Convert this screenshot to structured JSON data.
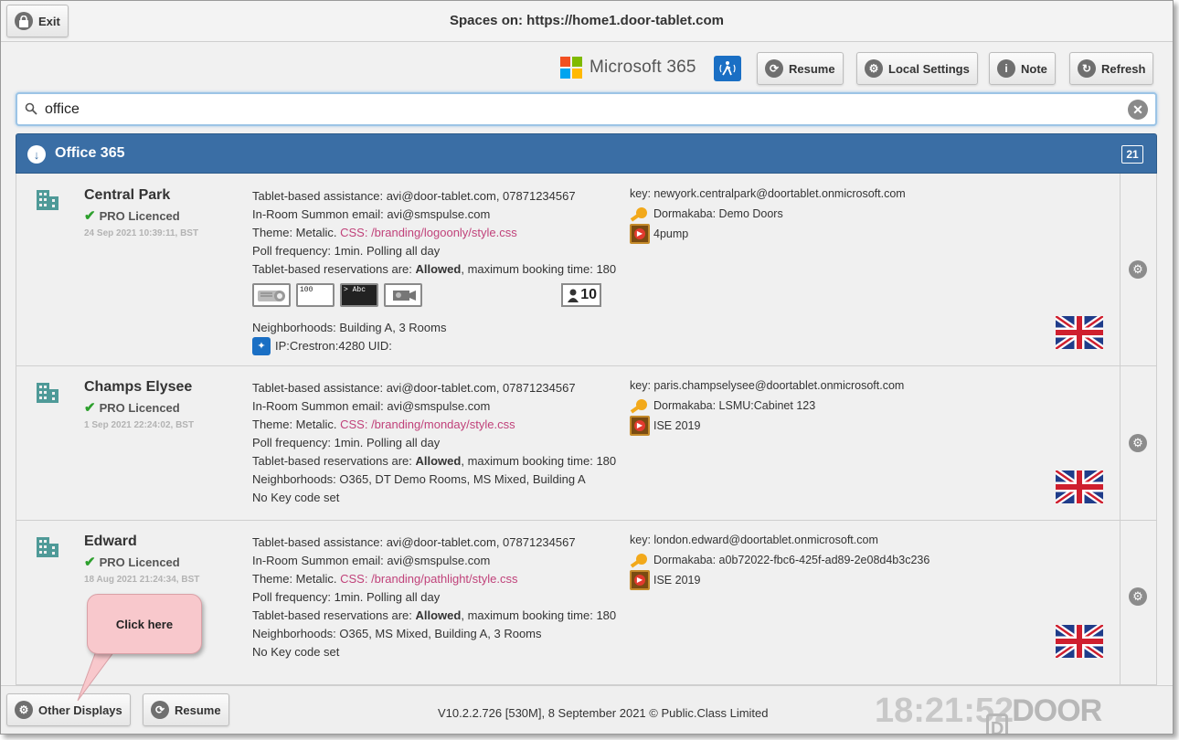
{
  "header": {
    "exit_label": "Exit",
    "title": "Spaces on: https://home1.door-tablet.com"
  },
  "toolbar": {
    "ms_brand": "Microsoft 365",
    "resume_label": "Resume",
    "local_settings_label": "Local Settings",
    "note_label": "Note",
    "refresh_label": "Refresh"
  },
  "search": {
    "value": "office"
  },
  "group": {
    "name": "Office 365",
    "count": "21"
  },
  "rooms": [
    {
      "name": "Central Park",
      "license": "PRO Licenced",
      "timestamp": "24 Sep 2021 10:39:11, BST",
      "assistance": "Tablet-based assistance: avi@door-tablet.com, 07871234567",
      "summon": "In-Room Summon email: avi@smspulse.com",
      "theme_prefix": "Theme: Metalic.",
      "theme_css": "CSS: /branding/logoonly/style.css",
      "poll": "Poll frequency: 1min. Polling all day",
      "res_prefix": "Tablet-based reservations are:",
      "res_allowed": "Allowed",
      "res_suffix": ", maximum booking time: 180",
      "neighborhoods": "Neighborhoods: Building A, 3 Rooms",
      "ip": "IP:Crestron:4280 UID:",
      "capacity": "10",
      "key": "key: newyork.centralpark@doortablet.onmicrosoft.com",
      "dormakaba": "Dormakaba: Demo Doors",
      "media": "4pump",
      "equipment": [
        "projector",
        "100",
        "> Abc",
        "camera"
      ]
    },
    {
      "name": "Champs Elysee",
      "license": "PRO Licenced",
      "timestamp": "1 Sep 2021 22:24:02, BST",
      "assistance": "Tablet-based assistance: avi@door-tablet.com, 07871234567",
      "summon": "In-Room Summon email: avi@smspulse.com",
      "theme_prefix": "Theme: Metalic.",
      "theme_css": "CSS: /branding/monday/style.css",
      "poll": "Poll frequency: 1min. Polling all day",
      "res_prefix": "Tablet-based reservations are:",
      "res_allowed": "Allowed",
      "res_suffix": ", maximum booking time: 180",
      "neighborhoods": "Neighborhoods: O365, DT Demo Rooms, MS Mixed, Building A",
      "keycode": "No Key code set",
      "key": "key: paris.champselysee@doortablet.onmicrosoft.com",
      "dormakaba": "Dormakaba: LSMU:Cabinet 123",
      "media": "ISE 2019"
    },
    {
      "name": "Edward",
      "license": "PRO Licenced",
      "timestamp": "18 Aug 2021 21:24:34, BST",
      "assistance": "Tablet-based assistance: avi@door-tablet.com, 07871234567",
      "summon": "In-Room Summon email: avi@smspulse.com",
      "theme_prefix": "Theme: Metalic.",
      "theme_css": "CSS: /branding/pathlight/style.css",
      "poll": "Poll frequency: 1min. Polling all day",
      "res_prefix": "Tablet-based reservations are:",
      "res_allowed": "Allowed",
      "res_suffix": ", maximum booking time: 180",
      "neighborhoods": "Neighborhoods: O365, MS Mixed, Building A, 3 Rooms",
      "keycode": "No Key code set",
      "key": "key: london.edward@doortablet.onmicrosoft.com",
      "dormakaba": "Dormakaba: a0b72022-fbc6-425f-ad89-2e08d4b3c236",
      "media": "ISE 2019"
    }
  ],
  "footer": {
    "other_displays_label": "Other Displays",
    "resume_label": "Resume",
    "version": "V10.2.2.726 [530M], 8 September 2021 © Public.Class Limited",
    "clock": "18:21:52",
    "brand": "DOOR TABLET",
    "brand_letter": "D"
  },
  "callout": {
    "text": "Click here"
  },
  "colors": {
    "group_bar": "#3a6ea5",
    "css_link": "#c0427a",
    "licence_tick": "#2da02d",
    "accent_blue": "#1a6fc4"
  }
}
